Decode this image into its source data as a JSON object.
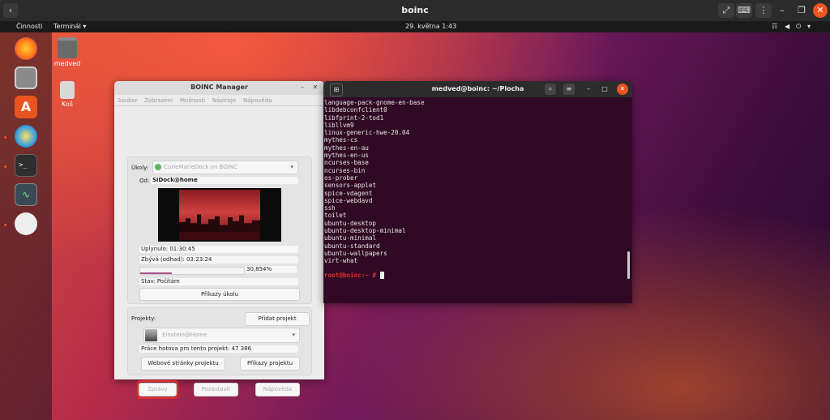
{
  "vm": {
    "title": "boinc",
    "back_icon": "chevron-left-icon"
  },
  "topbar": {
    "activities": "Činnosti",
    "app_menu": "Terminál ▾",
    "clock": "29. května  1:43"
  },
  "desktop": {
    "icons": [
      {
        "label": "medved"
      },
      {
        "label": "Koš"
      }
    ]
  },
  "boinc": {
    "title": "BOINC Manager",
    "menu": [
      "Soubor",
      "Zobrazení",
      "Možnosti",
      "Nástroje",
      "Nápověda"
    ],
    "tasks_label": "Úkoly:",
    "task_selected": "CurieMarieDock on BOINC",
    "from_label": "Od:",
    "from_value": "SiDock@home",
    "elapsed": "Uplynulo: 01:30:45",
    "remaining": "Zbývá (odhad): 03:23:24",
    "progress_text": "30,854%",
    "progress": 0.30854,
    "status": "Stav: Počítám",
    "task_commands": "Příkazy úkolu",
    "projects_label": "Projekty:",
    "add_project": "Přidat projekt",
    "project_selected": "Einstein@Home",
    "work_done": "Práce hotova pro tento projekt: 47 386",
    "web_pages": "Webové stránky projektu",
    "project_commands": "Příkazy projektu",
    "messages": "Zprávy",
    "suspend": "Pozastavit",
    "help": "Nápověda"
  },
  "terminal": {
    "title": "medved@boinc: ~/Plocha",
    "lines": [
      "language-pack-gnome-en-base",
      "libdebconfclient0",
      "libfprint-2-tod1",
      "libllvm9",
      "linux-generic-hwe-20.04",
      "mythes-cs",
      "mythes-en-au",
      "mythes-en-us",
      "ncurses-base",
      "ncurses-bin",
      "os-prober",
      "sensors-applet",
      "spice-vdagent",
      "spice-webdavd",
      "ssh",
      "toilet",
      "ubuntu-desktop",
      "ubuntu-desktop-minimal",
      "ubuntu-minimal",
      "ubuntu-standard",
      "ubuntu-wallpapers",
      "virt-what"
    ],
    "prompt": "root@boinc:~ # "
  },
  "colors": {
    "accent": "#e95420",
    "terminal_bg": "#300a24",
    "highlight": "#e03030"
  }
}
